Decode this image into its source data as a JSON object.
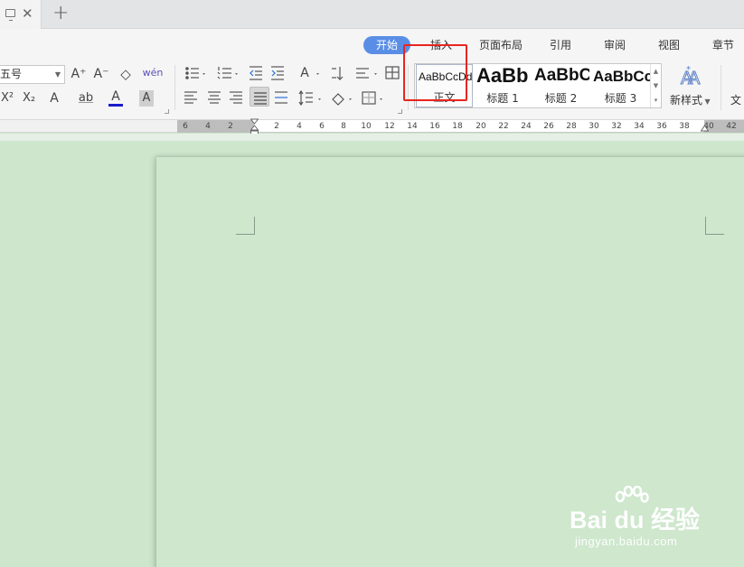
{
  "tabbar": {
    "close_glyph": "✕",
    "new_tab_glyph": "+",
    "icons": [
      "monitor-icon",
      "close-icon",
      "plus-icon"
    ]
  },
  "menu_tabs": [
    {
      "label": "开始",
      "active": true
    },
    {
      "label": "插入",
      "active": false
    },
    {
      "label": "页面布局",
      "active": false
    },
    {
      "label": "引用",
      "active": false
    },
    {
      "label": "审阅",
      "active": false
    },
    {
      "label": "视图",
      "active": false
    },
    {
      "label": "章节",
      "active": false
    }
  ],
  "font": {
    "size_value": "五号",
    "grow_glyph": "A⁺",
    "shrink_glyph": "A⁻",
    "eraser_glyph": "◇",
    "pinyin_glyph": "wén"
  },
  "format": {
    "superscript": "X²",
    "subscript": "X₂",
    "text_effect": "A",
    "highlight": "ab",
    "font_color": "A",
    "char_shading": "A"
  },
  "styles": {
    "items": [
      {
        "sample": "AaBbCcDd",
        "label": "正文"
      },
      {
        "sample": "AaBb",
        "label": "标题 1"
      },
      {
        "sample": "AaBbC",
        "label": "标题 2"
      },
      {
        "sample": "AaBbCc",
        "label": "标题 3"
      }
    ],
    "new_style_label": "新样式",
    "text_tool_label": "文"
  },
  "ruler": {
    "labels": [
      "6",
      "4",
      "2",
      "2",
      "4",
      "6",
      "8",
      "10",
      "12",
      "14",
      "16",
      "18",
      "20",
      "22",
      "24",
      "26",
      "28",
      "30",
      "32",
      "34",
      "36",
      "38",
      "40",
      "42"
    ]
  },
  "watermark": {
    "brand": "Bai du 经验",
    "url": "jingyan.baidu.com"
  },
  "colors": {
    "accent_active_tab": "#5a8ee6",
    "highlight_box": "#e8251e",
    "doc_background": "#cde6cc",
    "font_color_underline": "#1a1acc"
  }
}
